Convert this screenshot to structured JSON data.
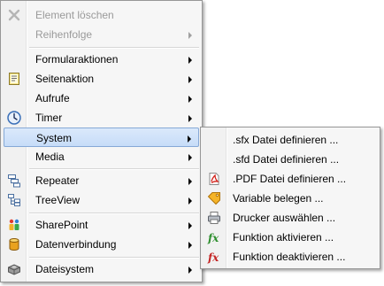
{
  "main_menu": {
    "items": [
      {
        "label": "Element löschen",
        "icon": "delete-x-icon",
        "disabled": true,
        "submenu": false
      },
      {
        "label": "Reihenfolge",
        "icon": "",
        "disabled": true,
        "submenu": true
      },
      {
        "label": "Formularaktionen",
        "icon": "",
        "disabled": false,
        "submenu": true
      },
      {
        "label": "Seitenaktion",
        "icon": "page-action-icon",
        "disabled": false,
        "submenu": true
      },
      {
        "label": "Aufrufe",
        "icon": "",
        "disabled": false,
        "submenu": true
      },
      {
        "label": "Timer",
        "icon": "clock-icon",
        "disabled": false,
        "submenu": true
      },
      {
        "label": "System",
        "icon": "",
        "disabled": false,
        "submenu": true,
        "selected": true
      },
      {
        "label": "Media",
        "icon": "",
        "disabled": false,
        "submenu": true
      },
      {
        "label": "Repeater",
        "icon": "repeater-icon",
        "disabled": false,
        "submenu": true
      },
      {
        "label": "TreeView",
        "icon": "treeview-icon",
        "disabled": false,
        "submenu": true
      },
      {
        "label": "SharePoint",
        "icon": "sharepoint-icon",
        "disabled": false,
        "submenu": true
      },
      {
        "label": "Datenverbindung",
        "icon": "database-icon",
        "disabled": false,
        "submenu": true
      },
      {
        "label": "Dateisystem",
        "icon": "filesystem-icon",
        "disabled": false,
        "submenu": true
      }
    ]
  },
  "system_submenu": {
    "items": [
      {
        "label": ".sfx Datei definieren ...",
        "icon": ""
      },
      {
        "label": ".sfd Datei definieren ...",
        "icon": ""
      },
      {
        "label": ".PDF Datei definieren ...",
        "icon": "pdf-icon"
      },
      {
        "label": "Variable belegen ...",
        "icon": "tag-icon"
      },
      {
        "label": "Drucker auswählen ...",
        "icon": "printer-icon"
      },
      {
        "label": "Funktion aktivieren ...",
        "icon": "function-green-icon"
      },
      {
        "label": "Funktion deaktivieren ...",
        "icon": "function-red-icon"
      }
    ]
  },
  "colors": {
    "selected_fill": "#c6dcf8",
    "selected_border": "#86a9d6",
    "disabled_text": "#9a9a9a"
  }
}
